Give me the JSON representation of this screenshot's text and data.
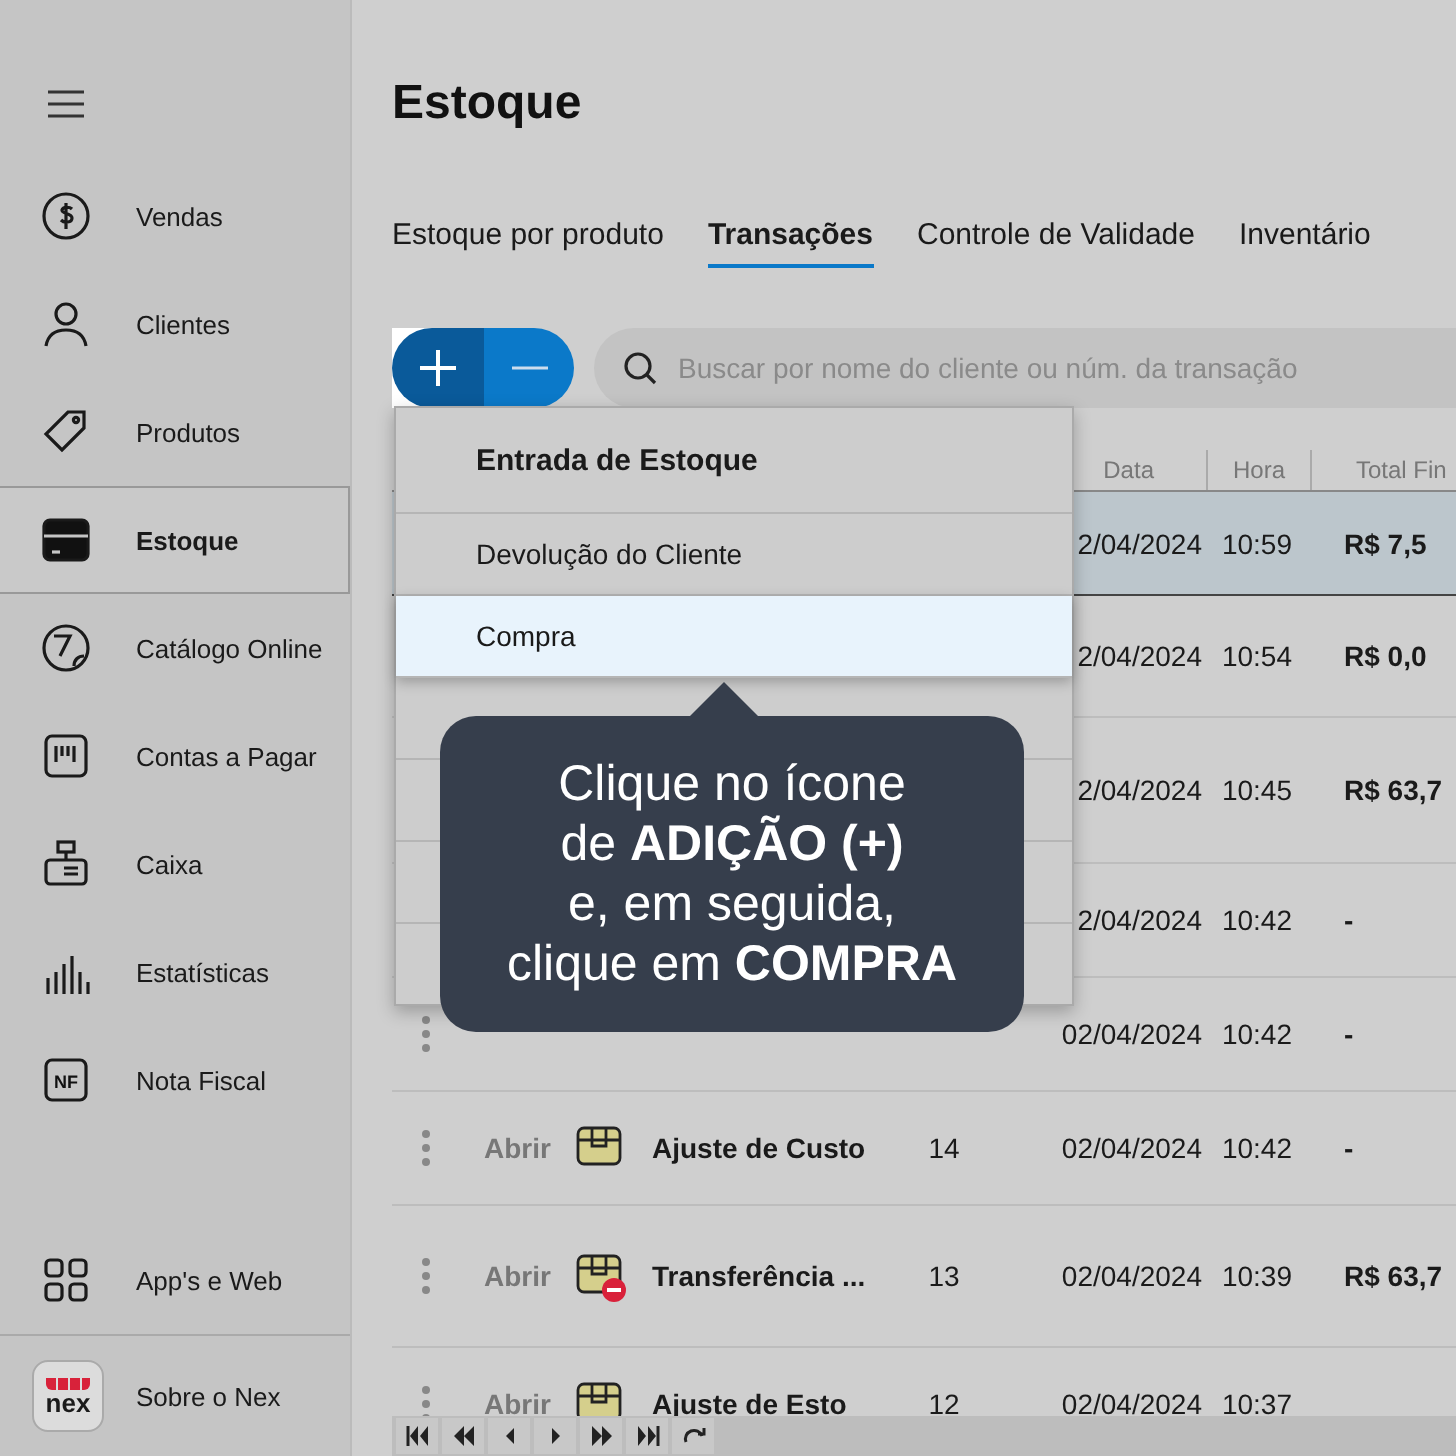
{
  "sidebar": {
    "items": [
      {
        "label": "Vendas",
        "selected": false
      },
      {
        "label": "Clientes",
        "selected": false
      },
      {
        "label": "Produtos",
        "selected": false
      },
      {
        "label": "Estoque",
        "selected": true
      },
      {
        "label": "Catálogo Online",
        "selected": false
      },
      {
        "label": "Contas a Pagar",
        "selected": false
      },
      {
        "label": "Caixa",
        "selected": false
      },
      {
        "label": "Estatísticas",
        "selected": false
      },
      {
        "label": "Nota Fiscal",
        "selected": false,
        "icon_text": "NF"
      }
    ],
    "apps": {
      "label": "App's e Web"
    },
    "about": {
      "logo": "nex",
      "label": "Sobre o Nex"
    }
  },
  "title": "Estoque",
  "tabs": [
    {
      "label": "Estoque por produto",
      "selected": false
    },
    {
      "label": "Transações",
      "selected": true
    },
    {
      "label": "Controle de Validade",
      "selected": false
    },
    {
      "label": "Inventário",
      "selected": false
    }
  ],
  "search": {
    "placeholder": "Buscar por nome do cliente ou núm. da transação"
  },
  "table": {
    "columns": [
      "Data",
      "Hora",
      "Total Fin"
    ],
    "rows": [
      {
        "date": "2/04/2024",
        "time": "10:59",
        "total": "R$ 7,5",
        "selected": true
      },
      {
        "date": "2/04/2024",
        "time": "10:54",
        "total": "R$ 0,0",
        "selected": false
      },
      {
        "date": "2/04/2024",
        "time": "10:45",
        "total": "R$ 63,7",
        "selected": false
      },
      {
        "date": "2/04/2024",
        "time": "10:42",
        "total": "-",
        "selected": false
      },
      {
        "date": "02/04/2024",
        "time": "10:42",
        "total": "-",
        "selected": false
      },
      {
        "open": "Abrir",
        "type": "Ajuste de Custo",
        "number": "14",
        "date": "02/04/2024",
        "time": "10:42",
        "total": "-",
        "selected": false,
        "removed": false
      },
      {
        "open": "Abrir",
        "type": "Transferência ...",
        "number": "13",
        "date": "02/04/2024",
        "time": "10:39",
        "total": "R$ 63,7",
        "selected": false,
        "removed": true
      },
      {
        "open": "Abrir",
        "type": "Ajuste de Esto",
        "number": "12",
        "date": "02/04/2024",
        "time": "10:37",
        "selected": false,
        "removed": false
      }
    ]
  },
  "menu": {
    "header": "Entrada de Estoque",
    "items": [
      {
        "label": "Devolução do Cliente",
        "selected": false
      },
      {
        "label": "Compra",
        "selected": true
      }
    ]
  },
  "tooltip": "Clique no ícone\nde **ADIÇÃO (+)**\ne, em seguida,\nclique em **COMPRA**"
}
